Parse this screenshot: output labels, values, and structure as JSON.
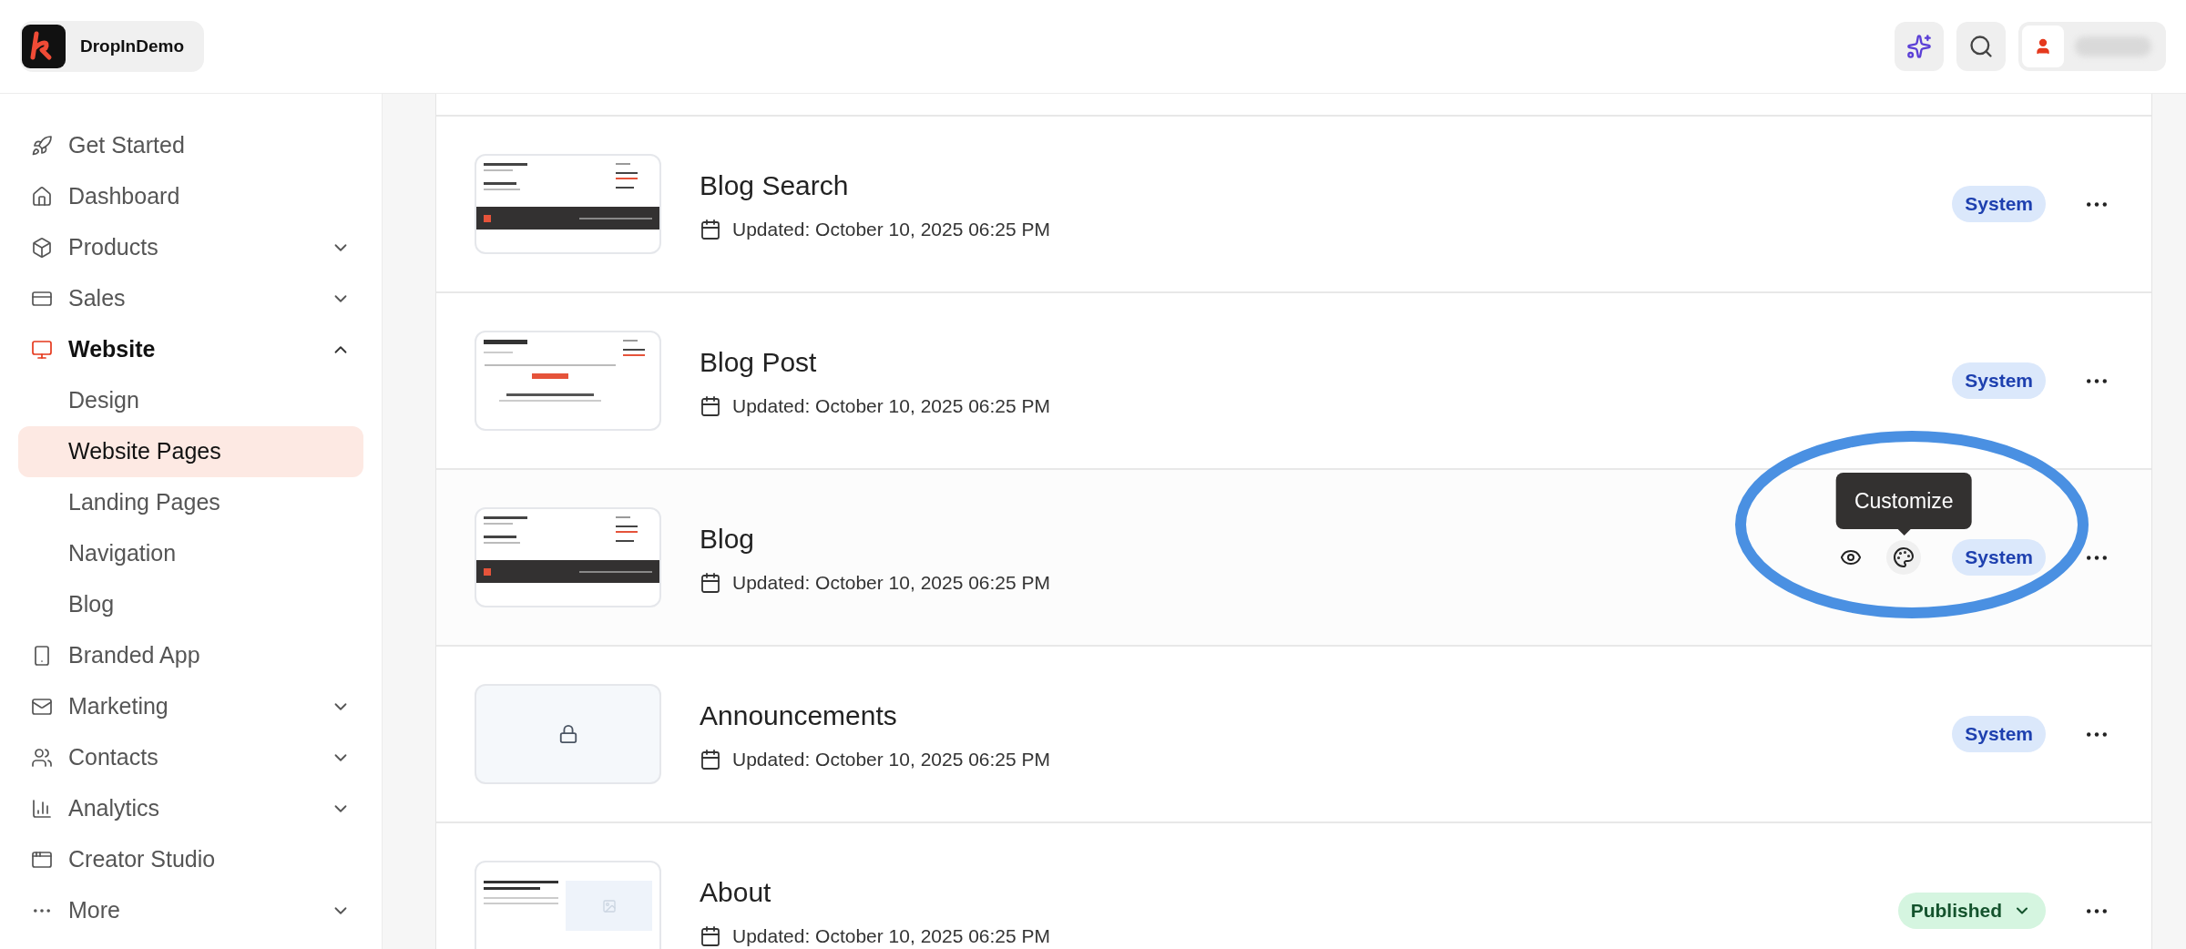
{
  "header": {
    "brand": "DropInDemo"
  },
  "sidebar": {
    "items": [
      {
        "label": "Get Started",
        "selected": false
      },
      {
        "label": "Dashboard",
        "selected": false
      },
      {
        "label": "Products",
        "selected": false,
        "expanded": false
      },
      {
        "label": "Sales",
        "selected": false,
        "expanded": false
      },
      {
        "label": "Website",
        "selected": true,
        "expanded": true,
        "children": [
          {
            "label": "Design",
            "selected": false
          },
          {
            "label": "Website Pages",
            "selected": true
          },
          {
            "label": "Landing Pages",
            "selected": false
          },
          {
            "label": "Navigation",
            "selected": false
          },
          {
            "label": "Blog",
            "selected": false
          }
        ]
      },
      {
        "label": "Branded App",
        "selected": false
      },
      {
        "label": "Marketing",
        "selected": false,
        "expanded": false
      },
      {
        "label": "Contacts",
        "selected": false,
        "expanded": false
      },
      {
        "label": "Analytics",
        "selected": false,
        "expanded": false
      },
      {
        "label": "Creator Studio",
        "selected": false
      },
      {
        "label": "More",
        "selected": false,
        "expanded": false
      }
    ]
  },
  "pages": [
    {
      "title": "Blog Search",
      "updated": "Updated: October 10, 2025 06:25 PM",
      "thumbnail": {
        "kind": "listing"
      },
      "status": {
        "label": "System",
        "kind": "system"
      },
      "hovered": false
    },
    {
      "title": "Blog Post",
      "updated": "Updated: October 10, 2025 06:25 PM",
      "thumbnail": {
        "kind": "post"
      },
      "status": {
        "label": "System",
        "kind": "system"
      },
      "hovered": false
    },
    {
      "title": "Blog",
      "updated": "Updated: October 10, 2025 06:25 PM",
      "thumbnail": {
        "kind": "listing"
      },
      "status": {
        "label": "System",
        "kind": "system"
      },
      "hovered": true,
      "tooltip": "Customize"
    },
    {
      "title": "Announcements",
      "updated": "Updated: October 10, 2025 06:25 PM",
      "thumbnail": {
        "kind": "locked"
      },
      "status": {
        "label": "System",
        "kind": "system"
      },
      "hovered": false
    },
    {
      "title": "About",
      "updated": "Updated: October 10, 2025 06:25 PM",
      "thumbnail": {
        "kind": "hero"
      },
      "status": {
        "label": "Published",
        "kind": "published"
      },
      "hovered": false
    }
  ]
}
